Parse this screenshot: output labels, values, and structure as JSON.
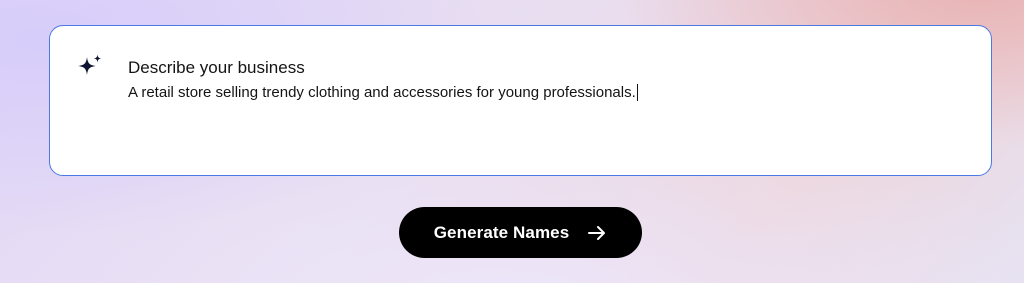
{
  "prompt": {
    "label": "Describe your business",
    "value": "A retail store selling trendy clothing and accessories for young professionals.",
    "icon": "sparkle-icon"
  },
  "action": {
    "generate_label": "Generate Names",
    "icon": "arrow-right-icon"
  },
  "colors": {
    "accent_border": "#4a79e6",
    "button_bg": "#000000",
    "text": "#141414"
  }
}
